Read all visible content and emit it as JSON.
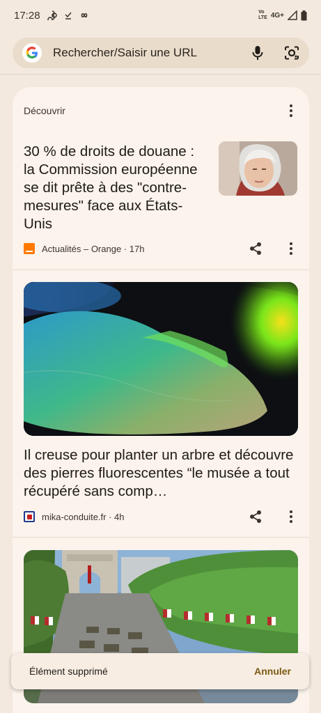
{
  "status_bar": {
    "time": "17:28",
    "network": "4G+",
    "volte_top": "Vo",
    "volte_bottom": "LTE"
  },
  "search": {
    "placeholder": "Rechercher/Saisir une URL",
    "icons": [
      "google-logo",
      "microphone-icon",
      "lens-camera-icon"
    ]
  },
  "discover": {
    "header": "Découvrir"
  },
  "articles": [
    {
      "title": "30 % de droits de douane : la Commission européenne se dit prête à des \"contre-mesures\" face aux États-Unis",
      "source": "Actualités – Orange · 17h",
      "source_color": "#ff7900"
    },
    {
      "title": "Il creuse pour planter un arbre et découvre des pierres fluorescentes “le musée a tout récupéré sans comp…",
      "source": "mika-conduite.fr · 4h",
      "source_color": "#1e3a8a"
    }
  ],
  "snackbar": {
    "message": "Élément supprimé",
    "action": "Annuler"
  },
  "colors": {
    "background": "#f3e9df",
    "card": "#fbf3ec",
    "accent_action": "#7a5b12"
  }
}
